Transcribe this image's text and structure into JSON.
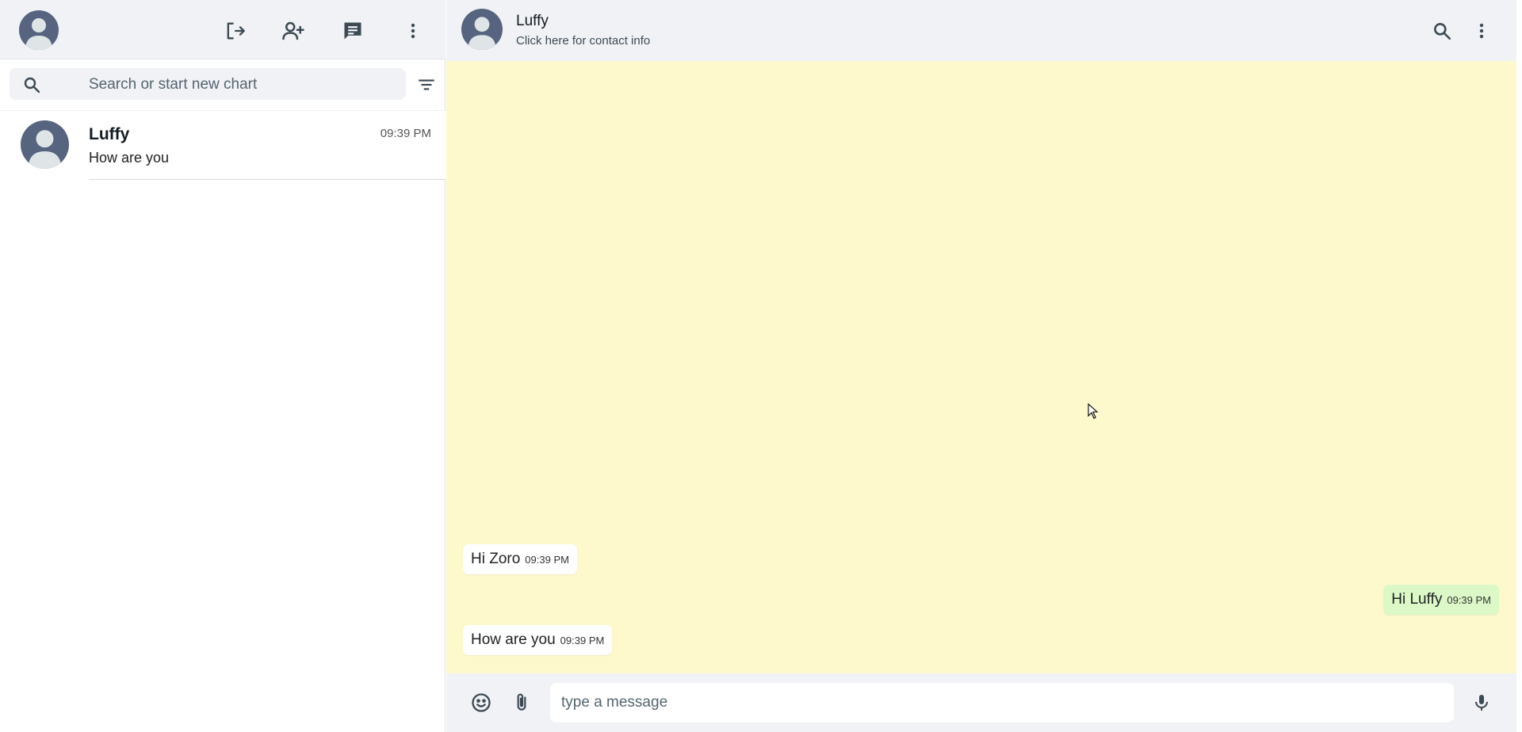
{
  "sidebar": {
    "header": {
      "profile_avatar": "user-avatar",
      "actions": [
        "logout-icon",
        "add-contact-icon",
        "new-chat-icon",
        "more-vert-icon"
      ]
    },
    "search": {
      "placeholder": "Search or start new chart",
      "value": ""
    },
    "chats": [
      {
        "name": "Luffy",
        "last_message": "How are you",
        "time": "09:39 PM"
      }
    ]
  },
  "conversation": {
    "contact_name": "Luffy",
    "contact_sub": "Click here for contact info",
    "messages": [
      {
        "direction": "in",
        "text": "Hi Zoro",
        "time": "09:39 PM"
      },
      {
        "direction": "out",
        "text": "Hi Luffy",
        "time": "09:39 PM"
      },
      {
        "direction": "in",
        "text": "How are you",
        "time": "09:39 PM"
      }
    ],
    "composer": {
      "placeholder": "type a message",
      "value": ""
    }
  },
  "colors": {
    "header_bg": "#f0f2f5",
    "chat_bg": "#fef8cd",
    "incoming_bubble": "#ffffff",
    "outgoing_bubble": "#dbf8c6",
    "avatar": "#56647f"
  }
}
